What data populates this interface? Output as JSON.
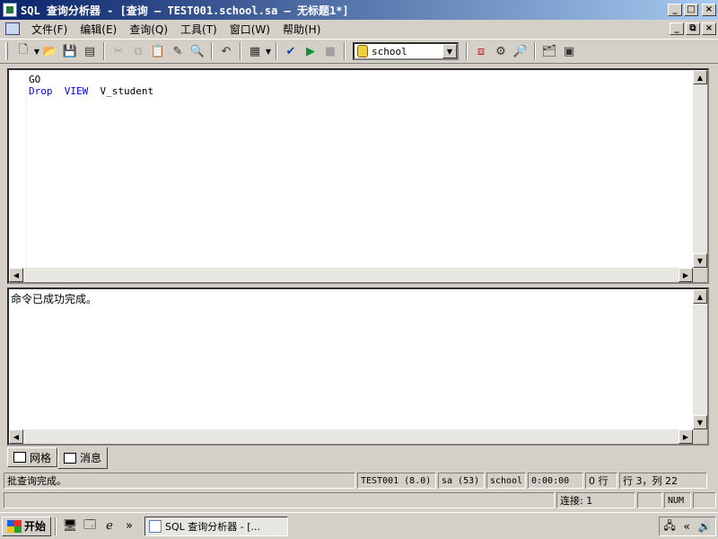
{
  "window": {
    "title": "SQL 查询分析器 - [查询 — TEST001.school.sa — 无标题1*]",
    "buttons": {
      "minimize": "_",
      "maximize": "□",
      "close": "×"
    },
    "mdi_buttons": {
      "minimize": "_",
      "restore": "⧉",
      "close": "×"
    }
  },
  "menu": {
    "items": [
      "文件(F)",
      "编辑(E)",
      "查询(Q)",
      "工具(T)",
      "窗口(W)",
      "帮助(H)"
    ]
  },
  "toolbar": {
    "database": "school"
  },
  "editor": {
    "lines": [
      {
        "text": "GO"
      },
      {
        "kw1": "Drop",
        "kw2": "VIEW",
        "name": "V_student"
      }
    ]
  },
  "results": {
    "message": "命令已成功完成。"
  },
  "tabs": [
    {
      "label": "网格"
    },
    {
      "label": "消息"
    }
  ],
  "status": {
    "main": "批查询完成。",
    "server": "TEST001 (8.0)",
    "user": "sa (53)",
    "database": "school",
    "time": "0:00:00",
    "rows": "0 行",
    "position": "行 3，列 22",
    "connections": "连接: 1",
    "num": "NUM"
  },
  "taskbar": {
    "start": "开始",
    "chevron": "»",
    "task": "SQL 查询分析器 - [..."
  }
}
